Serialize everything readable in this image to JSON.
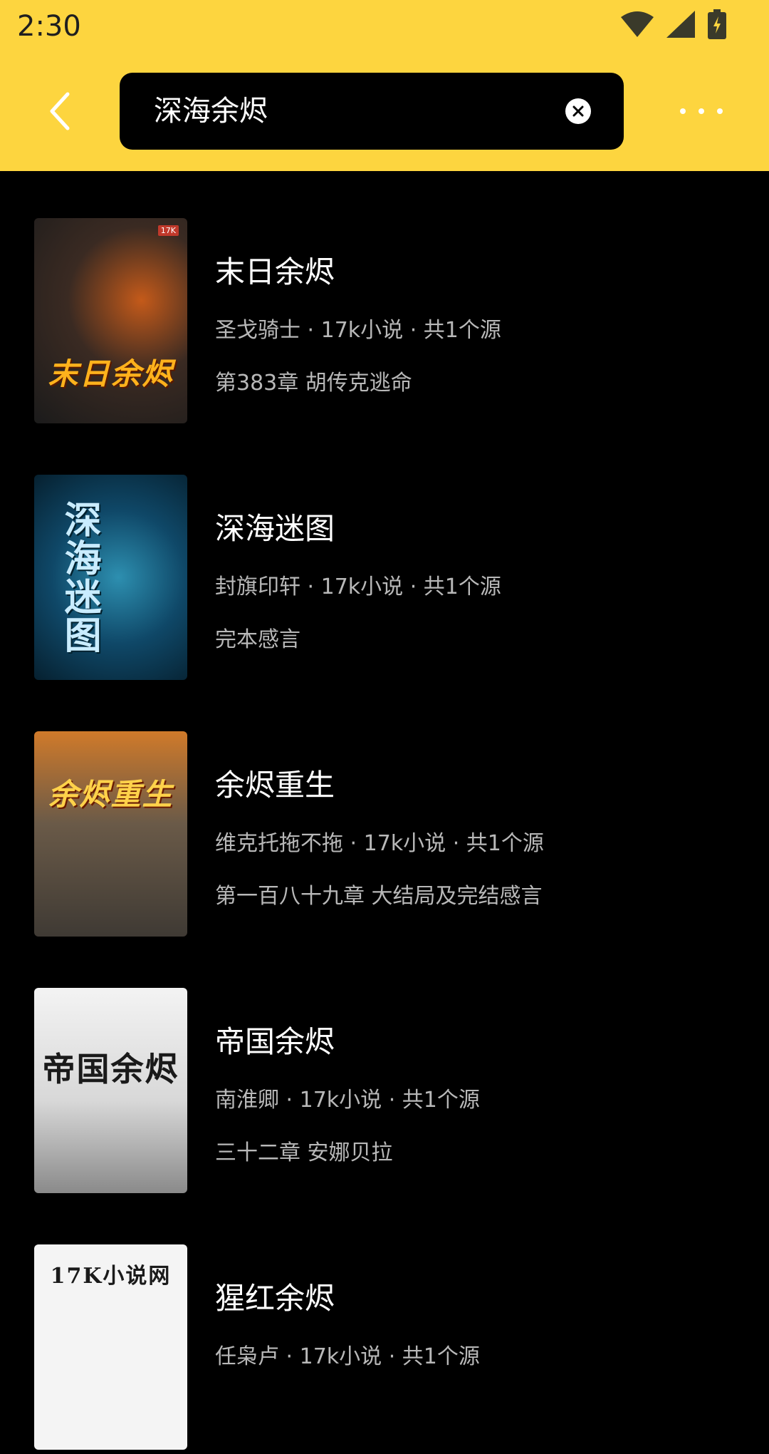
{
  "status_bar": {
    "time": "2:30"
  },
  "toolbar": {
    "search_value": "深海余烬"
  },
  "colors": {
    "header_bg": "#FDD53F",
    "background": "#000000",
    "meta_text": "#B8B8B8"
  },
  "results": [
    {
      "title": "末日余烬",
      "meta": "圣戈骑士 · 17k小说 · 共1个源",
      "latest": "第383章 胡传克逃命",
      "cover_text": "末日余烬"
    },
    {
      "title": "深海迷图",
      "meta": "封旗印轩 · 17k小说 · 共1个源",
      "latest": "完本感言",
      "cover_text": "深海迷图"
    },
    {
      "title": "余烬重生",
      "meta": "维克托拖不拖 · 17k小说 · 共1个源",
      "latest": "第一百八十九章 大结局及完结感言",
      "cover_text": "余烬重生"
    },
    {
      "title": "帝国余烬",
      "meta": "南淮卿 · 17k小说 · 共1个源",
      "latest": "三十二章 安娜贝拉",
      "cover_text": "帝国余烬"
    },
    {
      "title": "猩红余烬",
      "meta": "任枭卢 · 17k小说 · 共1个源",
      "latest": "",
      "cover_text": "17K小说网"
    }
  ]
}
